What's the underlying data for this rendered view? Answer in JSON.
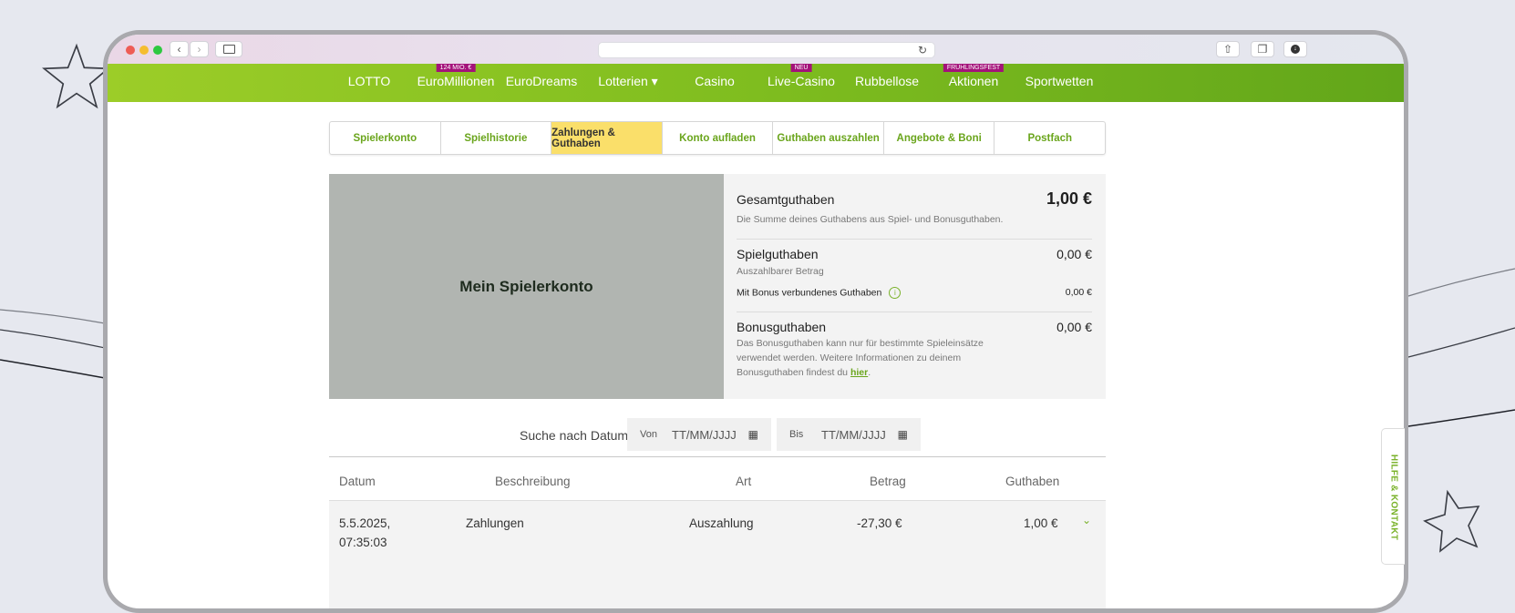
{
  "browser": {
    "icons": [
      "chevron-left-icon",
      "chevron-right-icon",
      "sidebar-icon",
      "reload-icon",
      "share-icon",
      "tabs-icon",
      "download-icon"
    ],
    "traffic_colors": [
      "#ee5c55",
      "#f5bd30",
      "#2ec840"
    ]
  },
  "nav": {
    "items": [
      {
        "label": "LOTTO",
        "badge": ""
      },
      {
        "label": "EuroMillionen",
        "badge": "124 MIO. €"
      },
      {
        "label": "EuroDreams",
        "badge": ""
      },
      {
        "label": "Lotterien ▾",
        "badge": ""
      },
      {
        "label": "Casino",
        "badge": ""
      },
      {
        "label": "Live-Casino",
        "badge": "NEU"
      },
      {
        "label": "Rubbellose",
        "badge": ""
      },
      {
        "label": "Aktionen",
        "badge": "FRÜHLINGSFEST"
      },
      {
        "label": "Sportwetten",
        "badge": ""
      }
    ]
  },
  "tabs": [
    {
      "label": "Spielerkonto"
    },
    {
      "label": "Spielhistorie"
    },
    {
      "label": "Zahlungen & Guthaben",
      "active": true
    },
    {
      "label": "Konto aufladen"
    },
    {
      "label": "Guthaben auszahlen"
    },
    {
      "label": "Angebote & Boni"
    },
    {
      "label": "Postfach"
    }
  ],
  "hero": {
    "title": "Mein Spielerkonto"
  },
  "balance": {
    "total": {
      "title": "Gesamtguthaben",
      "amount": "1,00 €",
      "desc": "Die Summe deines Guthabens aus Spiel- und Bonusguthaben."
    },
    "play": {
      "title": "Spielguthaben",
      "amount": "0,00 €",
      "desc": "Auszahlbarer Betrag"
    },
    "bonus_linked": {
      "title": "Mit Bonus verbundenes Guthaben",
      "amount": "0,00 €"
    },
    "bonus": {
      "title": "Bonusguthaben",
      "amount": "0,00 €",
      "desc_line1": "Das Bonusguthaben kann nur für bestimmte Spieleinsätze",
      "desc_line2": "verwendet werden. Weitere Informationen zu deinem",
      "desc_line3": "Bonusguthaben findest du ",
      "link": "hier",
      "desc_end": "."
    }
  },
  "search": {
    "label": "Suche nach Datum",
    "from_label": "Von",
    "from_placeholder": "TT/MM/JJJJ",
    "to_label": "Bis",
    "to_placeholder": "TT/MM/JJJJ"
  },
  "table": {
    "headers": {
      "date": "Datum",
      "desc": "Beschreibung",
      "type": "Art",
      "amount": "Betrag",
      "balance": "Guthaben"
    },
    "rows": [
      {
        "date": "5.5.2025,",
        "time": "07:35:03",
        "desc": "Zahlungen",
        "type": "Auszahlung",
        "amount": "-27,30 €",
        "balance": "1,00 €"
      }
    ]
  },
  "help": {
    "label": "HILFE & KONTAKT"
  },
  "colors": {
    "green": "#7ab22a",
    "active_tab": "#fadf6a",
    "badge": "#a4127a"
  }
}
